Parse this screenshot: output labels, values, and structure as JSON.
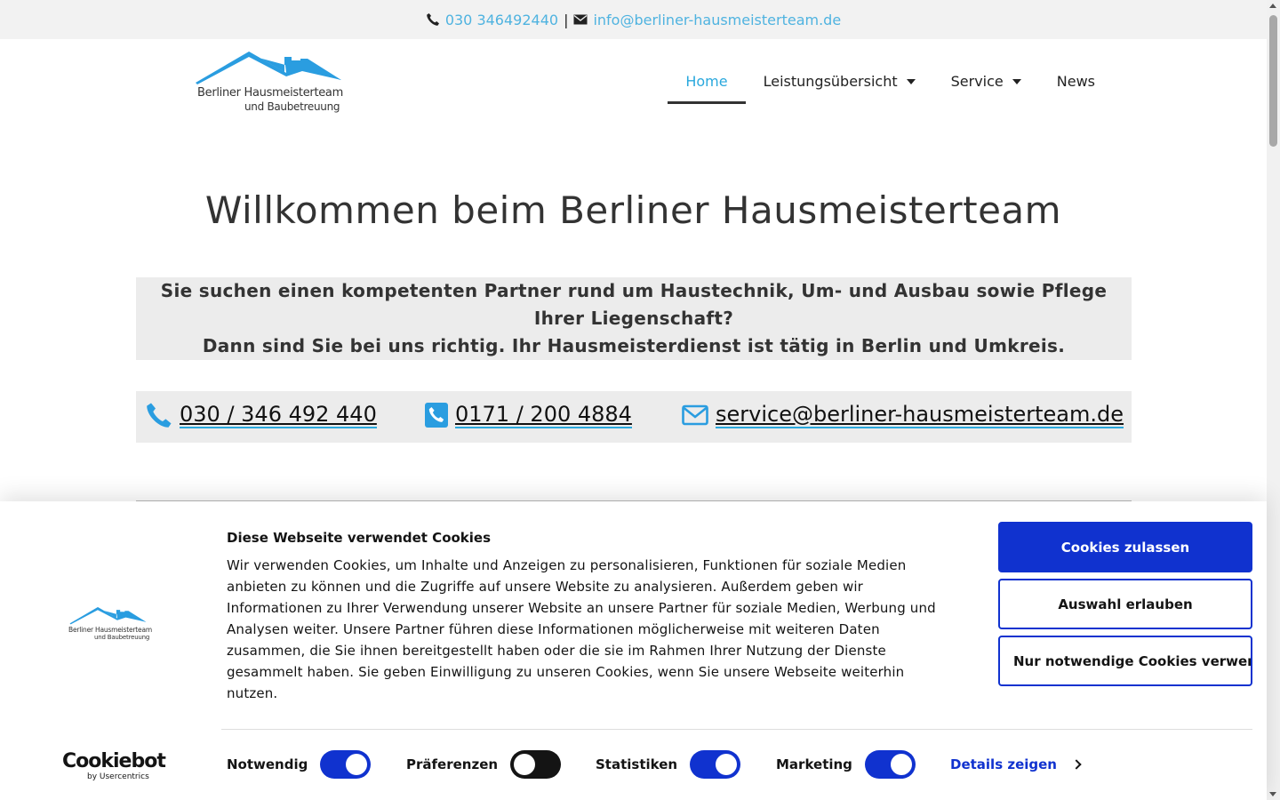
{
  "topbar": {
    "phone": "030 346492440",
    "separator": "|",
    "email": "info@berliner-hausmeisterteam.de"
  },
  "logo": {
    "line1": "Berliner Hausmeisterteam",
    "line2": "und Baubetreuung",
    "color": "#2a9de0"
  },
  "nav": {
    "items": [
      {
        "label": "Home",
        "active": true
      },
      {
        "label": "Leistungsübersicht",
        "dropdown": true
      },
      {
        "label": "Service",
        "dropdown": true
      },
      {
        "label": "News"
      }
    ]
  },
  "main": {
    "title": "Willkommen beim Berliner Hausmeisterteam",
    "intro_line1": "Sie suchen einen kompetenten Partner rund um Haustechnik, Um- und Ausbau sowie Pflege",
    "intro_line2": "Ihrer Liegenschaft?",
    "intro_line3": "Dann sind Sie bei uns richtig. Ihr Hausmeisterdienst ist tätig in Berlin und Umkreis.",
    "contacts": {
      "phone": "030 / 346 492 440",
      "mobile": "0171 / 200 4884",
      "email": "service@berliner-hausmeisterteam.de"
    }
  },
  "cookie": {
    "title": "Diese Webseite verwendet Cookies",
    "text": "Wir verwenden Cookies, um Inhalte und Anzeigen zu personalisieren, Funktionen für soziale Medien anbieten zu können und die Zugriffe auf unsere Website zu analysieren. Außerdem geben wir Informationen zu Ihrer Verwendung unserer Website an unsere Partner für soziale Medien, Werbung und Analysen weiter. Unsere Partner führen diese Informationen möglicherweise mit weiteren Daten zusammen, die Sie ihnen bereitgestellt haben oder die sie im Rahmen Ihrer Nutzung der Dienste gesammelt haben. Sie geben Einwilligung zu unseren Cookies, wenn Sie unsere Webseite weiterhin nutzen.",
    "buttons": {
      "allow_all": "Cookies zulassen",
      "allow_selection": "Auswahl erlauben",
      "necessary_only": "Nur notwendige Cookies verwenden"
    },
    "toggles": {
      "necessary": {
        "label": "Notwendig",
        "on": true
      },
      "preferences": {
        "label": "Präferenzen",
        "on": false
      },
      "statistics": {
        "label": "Statistiken",
        "on": true
      },
      "marketing": {
        "label": "Marketing",
        "on": true
      }
    },
    "details_label": "Details zeigen",
    "brand": {
      "name": "Cookiebot",
      "sub": "by Usercentrics"
    },
    "accent_color": "#1032cf"
  }
}
